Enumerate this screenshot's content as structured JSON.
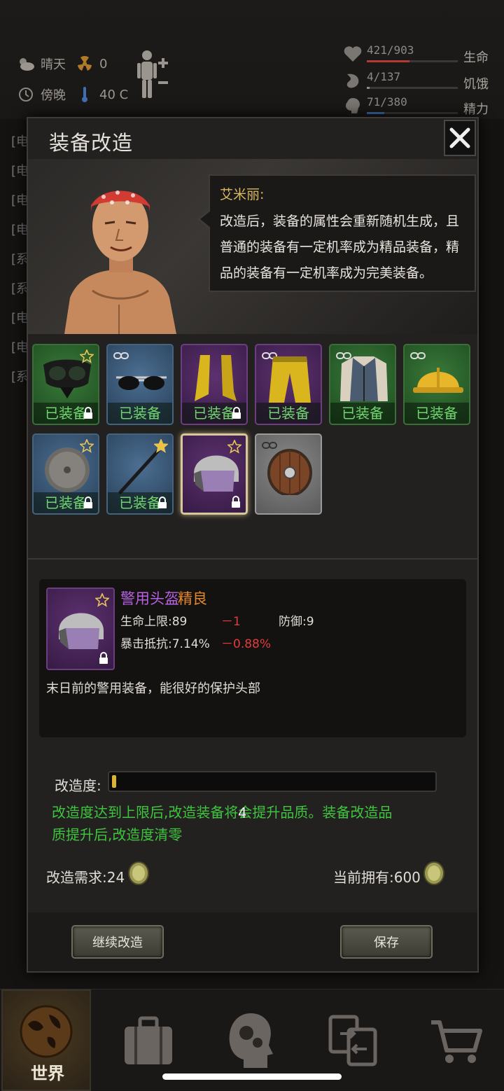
{
  "status": {
    "weather": "晴天",
    "radiation": "0",
    "time_of_day": "傍晚",
    "temperature": "40 C",
    "vitals": [
      {
        "value": "421/903",
        "label": "生命",
        "fraction": 0.47,
        "color": "#b23a32",
        "icon": "heart-icon"
      },
      {
        "value": "4/137",
        "label": "饥饿",
        "fraction": 0.03,
        "color": "#8d8a86",
        "icon": "stomach-icon"
      },
      {
        "value": "71/380",
        "label": "精力",
        "fraction": 0.19,
        "color": "#3e6fb0",
        "icon": "brain-icon"
      }
    ]
  },
  "background_log": [
    "[电",
    "[电",
    "[电",
    "[电",
    "[系",
    "[系",
    "[电",
    "[电",
    "[系"
  ],
  "modal": {
    "title": "装备改造",
    "speaker": "艾米丽:",
    "speech": "改造后，装备的属性会重新随机生成，且普通的装备有一定机率成为精品装备，精品的装备有一定机率成为完美装备。",
    "equipped_label": "已装备",
    "slots": [
      {
        "item": "goggles-mask",
        "rarity": "green",
        "equipped": true,
        "star": true,
        "chain": false,
        "lock": true
      },
      {
        "item": "sunglasses",
        "rarity": "blue",
        "equipped": true,
        "star": false,
        "chain": true,
        "lock": false
      },
      {
        "item": "yellow-boots",
        "rarity": "purple",
        "equipped": true,
        "star": false,
        "chain": false,
        "lock": true
      },
      {
        "item": "yellow-pants",
        "rarity": "purple",
        "equipped": true,
        "star": false,
        "chain": true,
        "lock": false
      },
      {
        "item": "vest-jacket",
        "rarity": "green",
        "equipped": true,
        "star": false,
        "chain": true,
        "lock": false
      },
      {
        "item": "hard-hat",
        "rarity": "green",
        "equipped": true,
        "star": false,
        "chain": true,
        "lock": false
      },
      {
        "item": "round-lid",
        "rarity": "blue",
        "equipped": true,
        "star": true,
        "chain": false,
        "lock": true
      },
      {
        "item": "staff",
        "rarity": "blue",
        "equipped": true,
        "star": true,
        "chain": false,
        "lock": true
      },
      {
        "item": "police-helmet",
        "rarity": "purple",
        "equipped": false,
        "star": true,
        "chain": false,
        "lock": true,
        "selected": true
      },
      {
        "item": "wooden-shield",
        "rarity": "gray",
        "equipped": false,
        "star": false,
        "chain": true,
        "lock": false
      }
    ],
    "detail": {
      "name": "警用头盔",
      "quality": "精良",
      "stats": [
        {
          "label": "生命上限:89",
          "delta": "－1"
        },
        {
          "label": "暴击抵抗:7.14%",
          "delta": "－0.88%"
        }
      ],
      "defense": "防御:9",
      "description": "末日前的警用装备，能很好的保护头部"
    },
    "progress": {
      "label": "改造度:",
      "value": "24",
      "overlay": "4",
      "fraction": 0.01
    },
    "hint": "改造度达到上限后,改造装备将会提升品质。装备改造品质提升后,改造度清零",
    "cost_label": "改造需求:24",
    "owned_label": "当前拥有:600",
    "buttons": {
      "continue": "继续改造",
      "save": "保存"
    }
  },
  "nav": {
    "world": "世界"
  }
}
